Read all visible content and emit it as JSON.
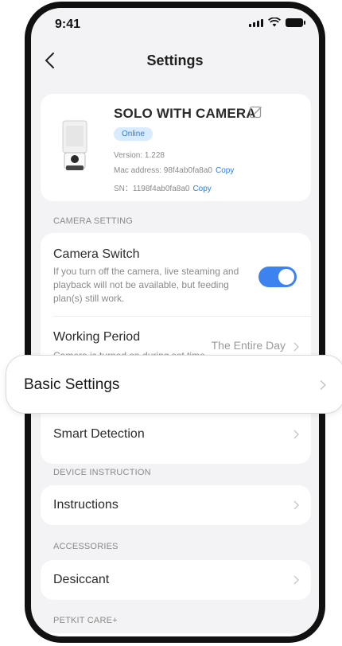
{
  "status_bar": {
    "time": "9:41"
  },
  "navbar": {
    "title": "Settings"
  },
  "device": {
    "name": "SOLO WITH CAMERA",
    "status": "Online",
    "version": "Version: 1.228",
    "mac": "Mac address: 98f4ab0fa8a0",
    "sn": "SN：1198f4ab0fa8a0",
    "copy_label": "Copy"
  },
  "sections": {
    "camera_setting": "CAMERA SETTING",
    "device_instruction": "DEVICE INSTRUCTION",
    "accessories": "ACCESSORIES",
    "petkit_care": "PETKIT CARE+"
  },
  "camera": {
    "switch_title": "Camera Switch",
    "switch_desc": "If you turn off the camera, live steaming and playback will not be available, but feeding plan(s) still work.",
    "switch_on": true,
    "working_title": "Working Period",
    "working_desc": "Camera is turned on during set time.",
    "working_value": "The Entire Day",
    "smart_detection": "Smart Detection"
  },
  "basic_settings": {
    "label": "Basic Settings"
  },
  "instructions": {
    "label": "Instructions"
  },
  "desiccant": {
    "label": "Desiccant"
  },
  "colors": {
    "accent": "#3c83ef",
    "badge_bg": "#d8ebff",
    "badge_text": "#2f7de1"
  }
}
